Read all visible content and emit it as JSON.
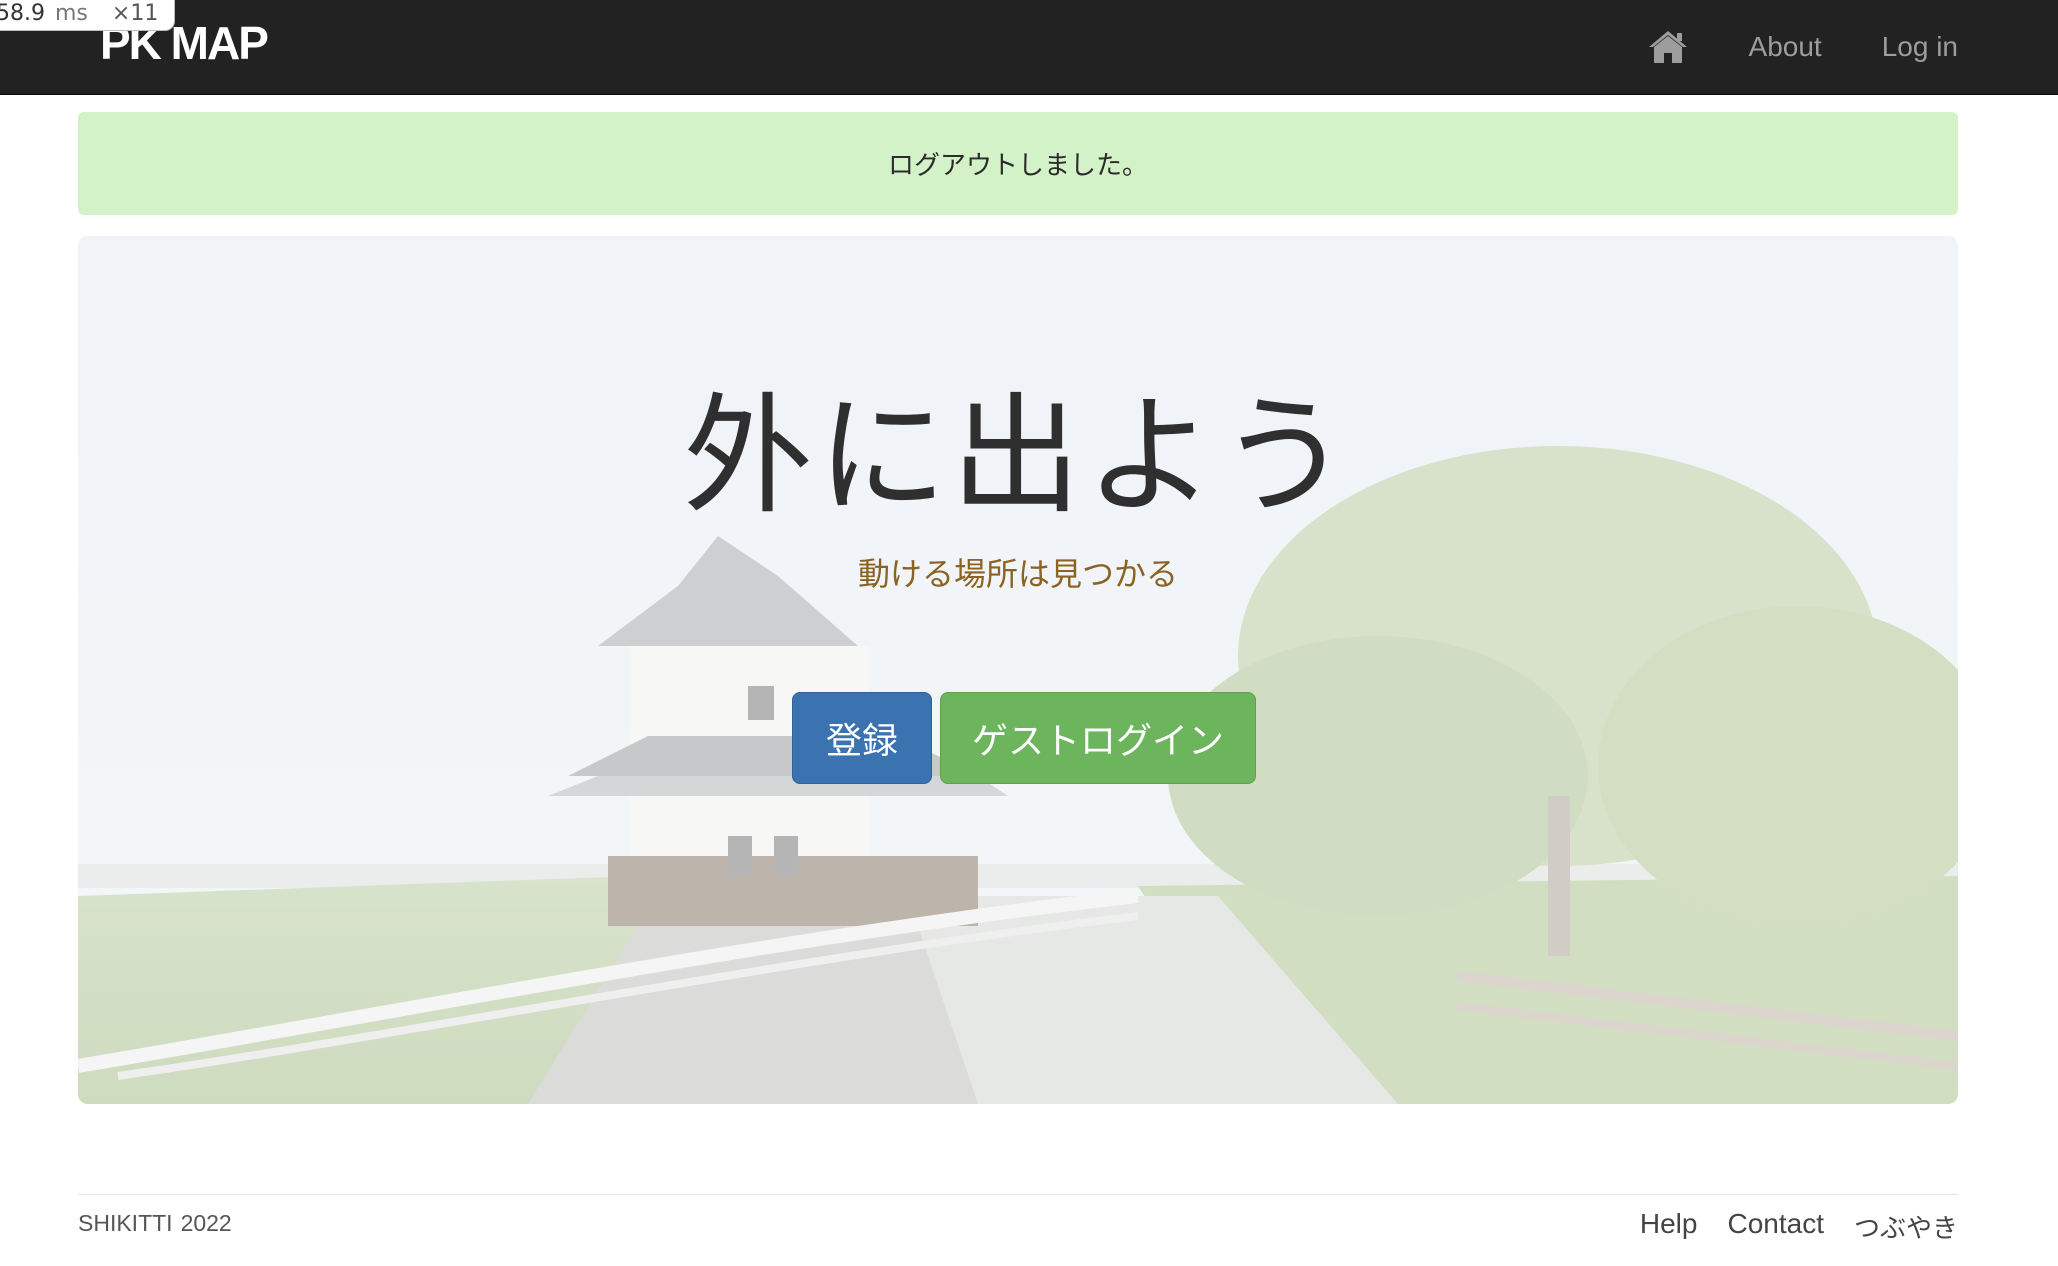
{
  "debug_badge": {
    "time_value": "58.9",
    "time_unit": "ms",
    "multiplier": "×11"
  },
  "navbar": {
    "brand": "PK MAP",
    "home_icon": "home-icon",
    "links": [
      "About",
      "Log in"
    ]
  },
  "alert": {
    "message": "ログアウトしました。",
    "color": "#d3f2c8"
  },
  "hero": {
    "title": "外に出よう",
    "subtitle": "動ける場所は見つかる",
    "primary_button": "登録",
    "secondary_button": "ゲストログイン",
    "primary_color": "#3b73b1",
    "secondary_color": "#6cb55d"
  },
  "footer": {
    "company": "SHIKITTI",
    "year": "2022",
    "links": [
      "Help",
      "Contact",
      "つぶやき"
    ]
  }
}
